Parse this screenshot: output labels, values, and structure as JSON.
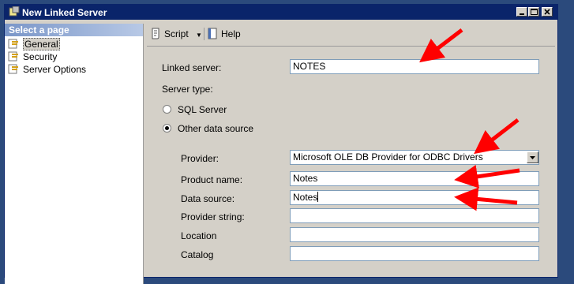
{
  "window": {
    "title": "New Linked Server",
    "controls": [
      "minimize",
      "maximize",
      "close"
    ]
  },
  "left_pane": {
    "header": "Select a page",
    "items": [
      {
        "label": "General",
        "selected": true,
        "icon": "page-icon"
      },
      {
        "label": "Security",
        "selected": false,
        "icon": "page-icon"
      },
      {
        "label": "Server Options",
        "selected": false,
        "icon": "page-icon"
      }
    ]
  },
  "toolbar": {
    "script_label": "Script",
    "help_label": "Help"
  },
  "form": {
    "linked_server_label": "Linked server:",
    "linked_server_value": "NOTES",
    "server_type_label": "Server type:",
    "sql_server_label": "SQL Server",
    "other_source_label": "Other data source",
    "selected_server_type": "Other data source",
    "provider_label": "Provider:",
    "provider_value": "Microsoft OLE DB Provider for ODBC Drivers",
    "product_name_label": "Product name:",
    "product_name_value": "Notes",
    "data_source_label": "Data source:",
    "data_source_value": "Notes",
    "provider_string_label": "Provider string:",
    "provider_string_value": "",
    "location_label": "Location",
    "location_value": "",
    "catalog_label": "Catalog",
    "catalog_value": ""
  },
  "annotations": {
    "arrow_color": "#ff0000",
    "arrow_count": 4
  },
  "colors": {
    "title_bar": "#0a246a",
    "panel": "#d4d0c8",
    "desktop": "#2b4a7c"
  }
}
